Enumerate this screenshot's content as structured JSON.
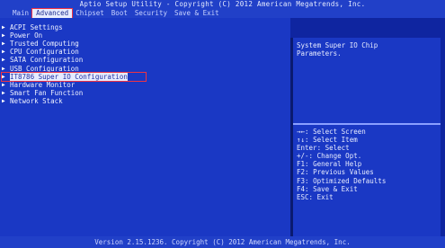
{
  "header": {
    "title": "Aptio Setup Utility - Copyright (C) 2012 American Megatrends, Inc.",
    "tabs": [
      {
        "label": "Main",
        "active": false
      },
      {
        "label": "Advanced",
        "active": true
      },
      {
        "label": "Chipset",
        "active": false
      },
      {
        "label": "Boot",
        "active": false
      },
      {
        "label": "Security",
        "active": false
      },
      {
        "label": "Save & Exit",
        "active": false
      }
    ]
  },
  "menu": {
    "items": [
      {
        "label": "ACPI Settings",
        "selected": false
      },
      {
        "label": "Power On",
        "selected": false
      },
      {
        "label": "Trusted Computing",
        "selected": false
      },
      {
        "label": "CPU Configuration",
        "selected": false
      },
      {
        "label": "SATA Configuration",
        "selected": false
      },
      {
        "label": "USB Configuration",
        "selected": false
      },
      {
        "label": "IT8786 Super IO Configuration",
        "selected": true
      },
      {
        "label": "Hardware Monitor",
        "selected": false
      },
      {
        "label": "Smart Fan Function",
        "selected": false
      },
      {
        "label": "Network Stack",
        "selected": false
      }
    ]
  },
  "help": {
    "description": "System Super IO Chip\nParameters."
  },
  "keys": [
    {
      "key": "→←",
      "action": "Select Screen"
    },
    {
      "key": "↑↓",
      "action": "Select Item"
    },
    {
      "key": "Enter",
      "action": "Select"
    },
    {
      "key": "+/-",
      "action": "Change Opt."
    },
    {
      "key": "F1",
      "action": "General Help"
    },
    {
      "key": "F2",
      "action": "Previous Values"
    },
    {
      "key": "F3",
      "action": "Optimized Defaults"
    },
    {
      "key": "F4",
      "action": "Save & Exit"
    },
    {
      "key": "ESC",
      "action": "Exit"
    }
  ],
  "footer": {
    "version": "Version 2.15.1236. Copyright (C) 2012 American Megatrends, Inc."
  },
  "colors": {
    "background": "#0f25a0",
    "panel": "#1a38c4",
    "header": "#2140c8",
    "highlight": "#e6ebff",
    "accent": "#ee3344"
  }
}
